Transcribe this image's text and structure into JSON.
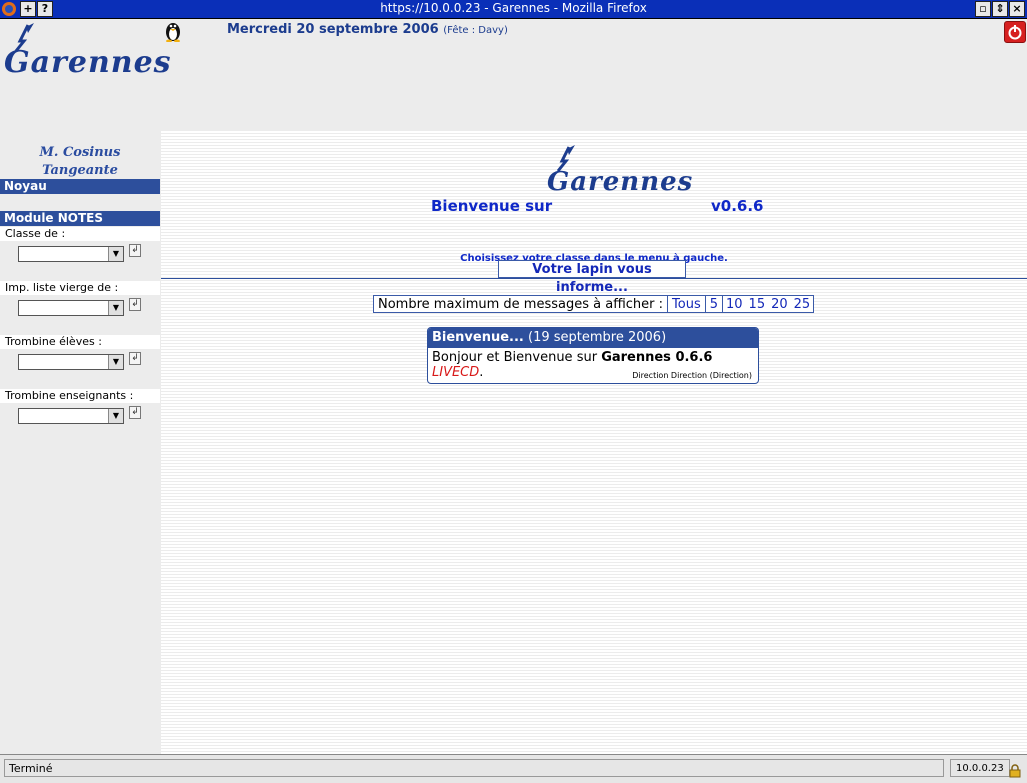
{
  "window": {
    "title": "https://10.0.0.23 - Garennes - Mozilla Firefox"
  },
  "header": {
    "logo_text": "Garennes",
    "date": "Mercredi 20 septembre 2006",
    "fete": "(Fête : Davy)"
  },
  "sidebar": {
    "user_line1": "M. Cosinus",
    "user_line2": "Tangeante",
    "section_noyau": "Noyau",
    "section_notes": "Module NOTES",
    "items": [
      {
        "label": "Classe de :"
      },
      {
        "label": "Imp. liste vierge de :"
      },
      {
        "label": "Trombine élèves :"
      },
      {
        "label": "Trombine enseignants :"
      }
    ]
  },
  "main": {
    "welcome_prefix": "Bienvenue sur",
    "logo_text": "Garennes",
    "version": "v0.6.6",
    "choose_text": "Choisissez votre classe dans le menu à gauche.",
    "lapin_button": "Votre lapin vous informe...",
    "max_messages": {
      "label": "Nombre maximum de messages à afficher :",
      "options": [
        "Tous",
        "5",
        "10",
        "15",
        "20",
        "25"
      ]
    },
    "message": {
      "title": "Bienvenue...",
      "date": "(19 septembre 2006)",
      "body_prefix": "Bonjour et Bienvenue sur",
      "body_bold": "Garennes 0.6.6",
      "body_live": "LIVECD",
      "body_suffix": ".",
      "author": "Direction Direction (Direction)"
    }
  },
  "statusbar": {
    "status": "Terminé",
    "host": "10.0.0.23"
  }
}
